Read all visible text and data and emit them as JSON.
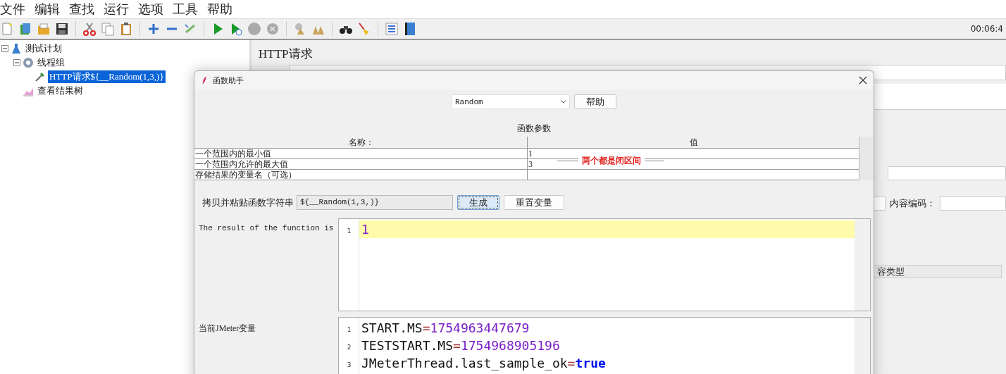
{
  "menu": [
    {
      "label": "文件"
    },
    {
      "label": "编辑"
    },
    {
      "label": "查找"
    },
    {
      "label": "运行"
    },
    {
      "label": "选项"
    },
    {
      "label": "工具"
    },
    {
      "label": "帮助"
    }
  ],
  "toolbar": {
    "timer": "00:06:4"
  },
  "tree": [
    {
      "label": "测试计划",
      "kind": "plan",
      "expanded": true,
      "selected": false,
      "children": [
        {
          "label": "线程组",
          "kind": "threads",
          "expanded": true,
          "selected": false,
          "children": [
            {
              "label": "HTTP请求${__Random(1,3,)}",
              "kind": "sampler",
              "selected": true
            }
          ]
        },
        {
          "label": "查看结果树",
          "kind": "listener",
          "selected": false
        }
      ]
    }
  ],
  "panel": {
    "title": "HTTP请求",
    "encoding_label": "内容编码：",
    "column_header": "容类型"
  },
  "dialog": {
    "title": "函数助手",
    "function": "Random",
    "help": "帮助",
    "params_title": "函数参数",
    "columns": [
      "名称：",
      "值"
    ],
    "rows": [
      {
        "name": "一个范围内的最小值",
        "value": "1"
      },
      {
        "name": "一个范围内允许的最大值",
        "value": "3"
      },
      {
        "name": "存储结果的变量名（可选）"
      }
    ],
    "note": "两个都是闭区间",
    "copy_label": "拷贝并粘贴函数字符串",
    "copy_value": "${__Random(1,3,)}",
    "generate": "生成",
    "reset": "重置变量",
    "result_label": "The result of the function is",
    "result_lines": [
      {
        "num": "1",
        "tokens": [
          {
            "text": "1",
            "kind": "number"
          }
        ]
      }
    ],
    "vars_label": "当前JMeter变量",
    "var_lines": [
      {
        "num": "1",
        "tokens": [
          {
            "text": "START.MS",
            "kind": "name"
          },
          {
            "text": "=",
            "kind": "op"
          },
          {
            "text": "1754963447679",
            "kind": "number"
          }
        ]
      },
      {
        "num": "2",
        "tokens": [
          {
            "text": "TESTSTART.MS",
            "kind": "name"
          },
          {
            "text": "=",
            "kind": "op"
          },
          {
            "text": "1754968905196",
            "kind": "number"
          }
        ]
      },
      {
        "num": "3",
        "tokens": [
          {
            "text": "JMeterThread.last_sample_ok",
            "kind": "name"
          },
          {
            "text": "=",
            "kind": "op"
          },
          {
            "text": "true",
            "kind": "keyword"
          }
        ]
      }
    ]
  }
}
